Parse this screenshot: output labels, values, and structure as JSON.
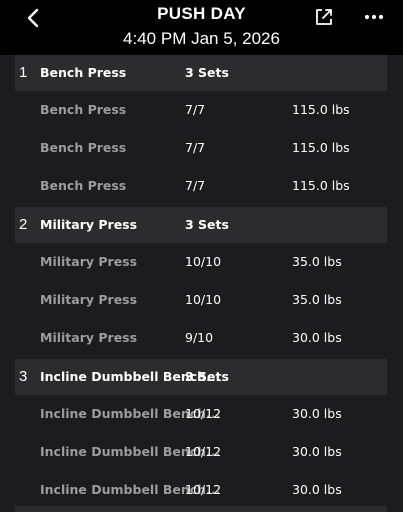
{
  "header": {
    "title": "PUSH DAY",
    "datetime": "4:40 PM Jan 5, 2026",
    "back_icon": "chevron-left-icon",
    "share_icon": "share-icon",
    "more_icon": "more-horizontal-icon"
  },
  "exercises": [
    {
      "number": "1",
      "name": "Bench Press",
      "sets_label": "3 Sets",
      "sets": [
        {
          "name": "Bench Press",
          "reps": "7/7",
          "weight": "115.0 lbs"
        },
        {
          "name": "Bench Press",
          "reps": "7/7",
          "weight": "115.0 lbs"
        },
        {
          "name": "Bench Press",
          "reps": "7/7",
          "weight": "115.0 lbs"
        }
      ]
    },
    {
      "number": "2",
      "name": "Military Press",
      "sets_label": "3 Sets",
      "sets": [
        {
          "name": "Military Press",
          "reps": "10/10",
          "weight": "35.0 lbs"
        },
        {
          "name": "Military Press",
          "reps": "10/10",
          "weight": "35.0 lbs"
        },
        {
          "name": "Military Press",
          "reps": "9/10",
          "weight": "30.0 lbs"
        }
      ]
    },
    {
      "number": "3",
      "name": "Incline Dumbbell Bench...",
      "sets_label": "3 Sets",
      "sets": [
        {
          "name": "Incline Dumbbell Bench...",
          "reps": "10/12",
          "weight": "30.0 lbs"
        },
        {
          "name": "Incline Dumbbell Bench...",
          "reps": "10/12",
          "weight": "30.0 lbs"
        },
        {
          "name": "Incline Dumbbell Bench...",
          "reps": "10/12",
          "weight": "30.0 lbs"
        }
      ]
    }
  ]
}
